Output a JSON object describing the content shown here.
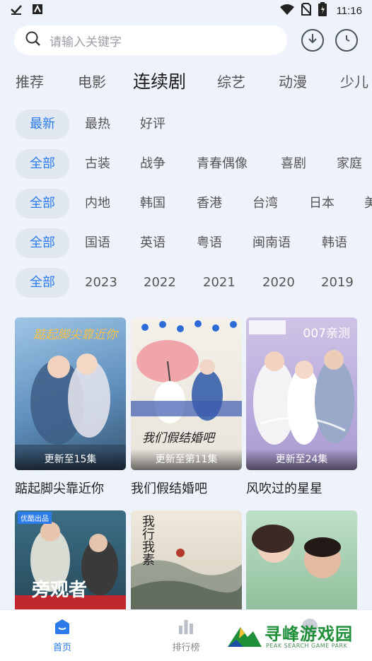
{
  "status_bar": {
    "time": "11:16"
  },
  "search": {
    "placeholder": "请输入关键字"
  },
  "tabs": [
    "推荐",
    "电影",
    "连续剧",
    "综艺",
    "动漫",
    "少儿"
  ],
  "filters": {
    "sort": [
      "最新",
      "最热",
      "好评"
    ],
    "genre": [
      "全部",
      "古装",
      "战争",
      "青春偶像",
      "喜剧",
      "家庭"
    ],
    "region": [
      "全部",
      "内地",
      "韩国",
      "香港",
      "台湾",
      "日本",
      "美"
    ],
    "language": [
      "全部",
      "国语",
      "英语",
      "粤语",
      "闽南语",
      "韩语"
    ],
    "year": [
      "全部",
      "2023",
      "2022",
      "2021",
      "2020",
      "2019"
    ]
  },
  "cards": [
    {
      "title": "踮起脚尖靠近你",
      "episode": "更新至15集",
      "poster_text": "踮起脚尖靠近你"
    },
    {
      "title": "我们假结婚吧",
      "episode": "更新至第11集",
      "poster_text": "我们假结婚吧"
    },
    {
      "title": "风吹过的星星",
      "episode": "更新至24集",
      "poster_text": "007亲测"
    }
  ],
  "cards_row2": [
    {
      "poster_text": "旁观者",
      "badge": "优酷出品"
    },
    {
      "poster_text": "我行我素"
    },
    {
      "poster_text": ""
    }
  ],
  "bottom_nav": [
    {
      "label": "首页",
      "icon": "home-icon"
    },
    {
      "label": "排行榜",
      "icon": "chart-icon"
    },
    {
      "label": "",
      "icon": "user-icon"
    }
  ],
  "watermark": {
    "title": "寻峰游戏园",
    "subtitle": "PEAK SEARCH GAME PARK"
  },
  "colors": {
    "accent": "#2b7bea",
    "background": "#eef3fb",
    "chip_bg": "#e2e8f2"
  }
}
